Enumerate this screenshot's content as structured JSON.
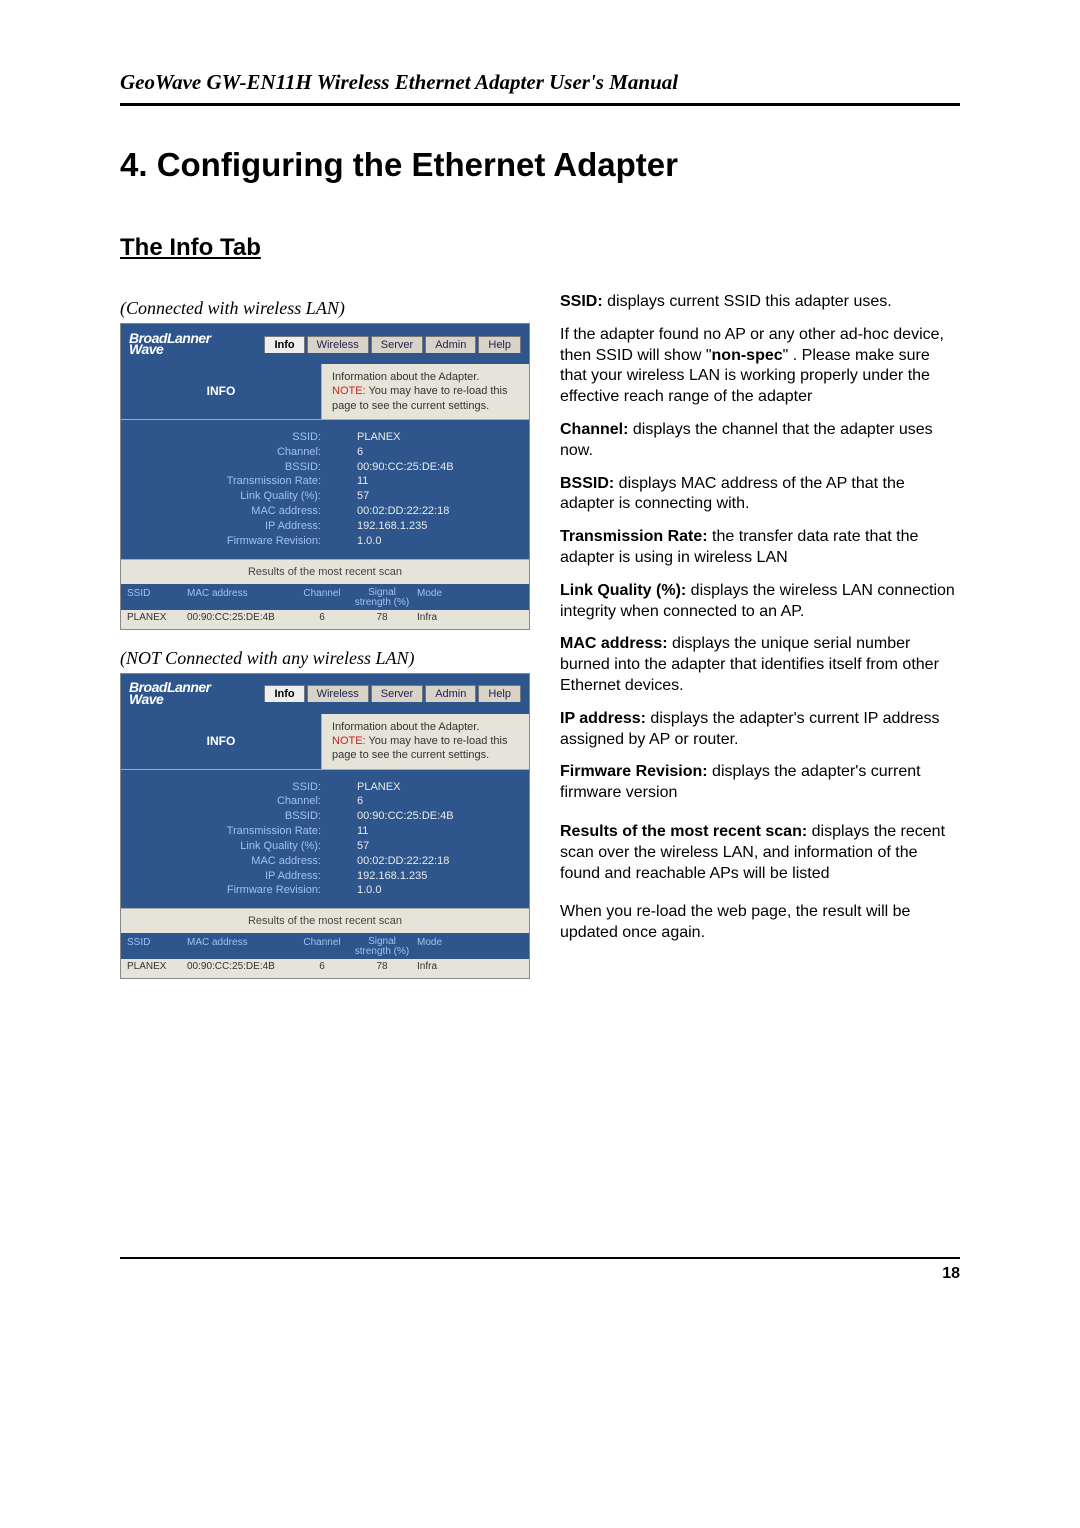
{
  "header": {
    "title": "GeoWave GW-EN11H Wireless Ethernet Adapter User's Manual"
  },
  "section": {
    "number_title": "4. Configuring the Ethernet Adapter",
    "subsection": "The Info Tab"
  },
  "captions": {
    "connected": "(Connected with wireless LAN)",
    "not_connected": "(NOT Connected with any wireless LAN)"
  },
  "shot_common": {
    "logo_line1": "BroadLanner",
    "logo_line2": "Wave",
    "tabs": [
      "Info",
      "Wireless",
      "Server",
      "Admin",
      "Help"
    ],
    "info_label": "INFO",
    "head_desc": "Information about the Adapter.",
    "head_note_label": "NOTE:",
    "head_note_text": " You may have to re-load this page to see the current settings.",
    "labels": {
      "ssid": "SSID:",
      "channel": "Channel:",
      "bssid": "BSSID:",
      "txrate": "Transmission Rate:",
      "linkq": "Link Quality (%):",
      "mac": "MAC address:",
      "ip": "IP Address:",
      "fw": "Firmware Revision:"
    },
    "values": {
      "ssid": "PLANEX",
      "channel": "6",
      "bssid": "00:90:CC:25:DE:4B",
      "txrate": "11",
      "linkq": "57",
      "mac": "00:02:DD:22:22:18",
      "ip": "192.168.1.235",
      "fw": "1.0.0"
    },
    "scan_title": "Results of the most recent scan",
    "scan_cols": {
      "ssid": "SSID",
      "mac": "MAC address",
      "chan": "Channel",
      "sig_line1": "Signal",
      "sig_line2": "strength (%)",
      "mode": "Mode"
    },
    "scan_row": {
      "ssid": "PLANEX",
      "mac": "00:90:CC:25:DE:4B",
      "chan": "6",
      "sig": "78",
      "mode": "Infra"
    }
  },
  "right": {
    "p_ssid_b": "SSID:",
    "p_ssid_t": " displays current SSID this adapter uses.",
    "p_nonspec_a": "If the adapter found no AP or any other ad-hoc device, then SSID will show \"",
    "p_nonspec_b": "non-spec",
    "p_nonspec_c": "\" . Please make sure that your wireless LAN is working properly under the effective reach range of the adapter",
    "p_channel_b": "Channel:",
    "p_channel_t": " displays the channel that the adapter uses now.",
    "p_bssid_b": "BSSID:",
    "p_bssid_t": " displays MAC address of the AP that the adapter is connecting with.",
    "p_tx_b": "Transmission Rate:",
    "p_tx_t": " the transfer data rate that the adapter is using in wireless LAN",
    "p_lq_b": "Link Quality (%):",
    "p_lq_t": " displays the wireless LAN connection integrity when connected to an AP.",
    "p_mac_b": "MAC address:",
    "p_mac_t": " displays the unique serial number burned into the adapter that identifies itself from other Ethernet devices.",
    "p_ip_b": "IP address:",
    "p_ip_t": " displays the adapter's current IP address assigned by AP or router.",
    "p_fw_b": "Firmware Revision:",
    "p_fw_t": " displays the adapter's current firmware version",
    "p_res_b": "Results of the most recent scan:",
    "p_res_t": " displays the recent scan over the wireless LAN, and information of the found and reachable APs will be listed",
    "p_reload": "When you re-load the web page, the result will be updated once again."
  },
  "footer": {
    "page": "18"
  }
}
